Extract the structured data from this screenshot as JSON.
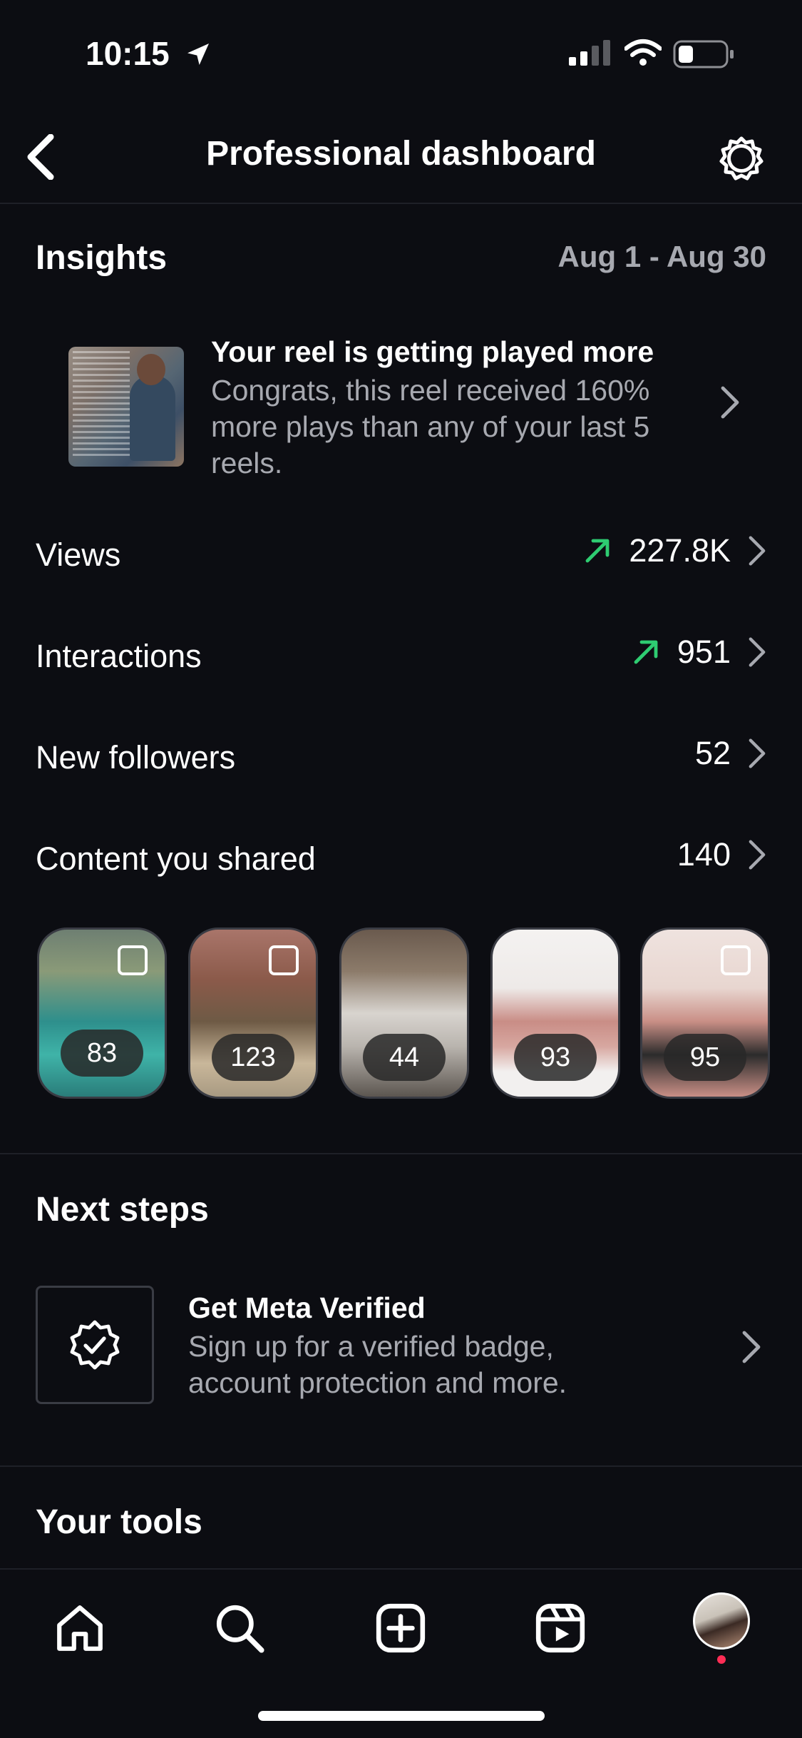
{
  "status_bar": {
    "time": "10:15"
  },
  "header": {
    "title": "Professional dashboard"
  },
  "insights": {
    "title": "Insights",
    "date_range": "Aug 1 - Aug 30",
    "highlight": {
      "title": "Your reel is getting played more",
      "body": "Congrats, this reel received 160% more plays than any of your last 5 reels."
    },
    "metrics": [
      {
        "label": "Views",
        "value": "227.8K",
        "trend": "up"
      },
      {
        "label": "Interactions",
        "value": "951",
        "trend": "up"
      },
      {
        "label": "New followers",
        "value": "52",
        "trend": "none"
      },
      {
        "label": "Content you shared",
        "value": "140",
        "trend": "none"
      }
    ],
    "content": [
      {
        "count": "83"
      },
      {
        "count": "123"
      },
      {
        "count": "44"
      },
      {
        "count": "93"
      },
      {
        "count": "95"
      }
    ]
  },
  "next_steps": {
    "title": "Next steps",
    "meta_verified": {
      "title": "Get Meta Verified",
      "body": "Sign up for a verified badge, account protection and more."
    }
  },
  "tools": {
    "title": "Your tools"
  },
  "colors": {
    "trend_up": "#2ecc71",
    "secondary_text": "#a7a9b0",
    "notification_dot": "#ff2d55"
  },
  "icons": [
    "back-icon",
    "settings-icon",
    "trend-up-icon",
    "chevron-right-icon",
    "verified-badge-icon",
    "home-icon",
    "search-icon",
    "create-icon",
    "reels-icon"
  ]
}
